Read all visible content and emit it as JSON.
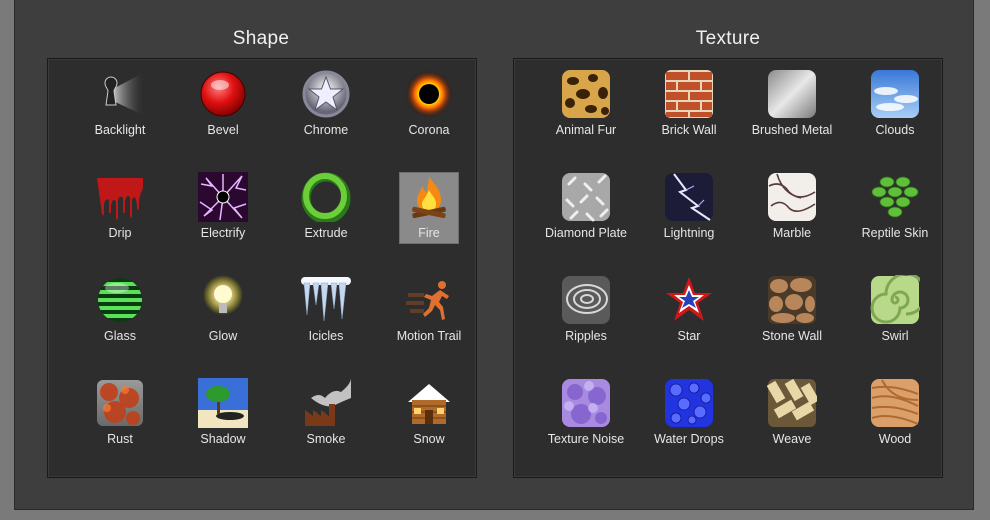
{
  "shape": {
    "title": "Shape",
    "items": [
      {
        "label": "Backlight",
        "icon": "backlight-icon"
      },
      {
        "label": "Bevel",
        "icon": "bevel-icon"
      },
      {
        "label": "Chrome",
        "icon": "chrome-icon"
      },
      {
        "label": "Corona",
        "icon": "corona-icon"
      },
      {
        "label": "Drip",
        "icon": "drip-icon"
      },
      {
        "label": "Electrify",
        "icon": "electrify-icon"
      },
      {
        "label": "Extrude",
        "icon": "extrude-icon"
      },
      {
        "label": "Fire",
        "icon": "fire-icon",
        "selected": true
      },
      {
        "label": "Glass",
        "icon": "glass-icon"
      },
      {
        "label": "Glow",
        "icon": "glow-icon"
      },
      {
        "label": "Icicles",
        "icon": "icicles-icon"
      },
      {
        "label": "Motion Trail",
        "icon": "motion-trail-icon"
      },
      {
        "label": "Rust",
        "icon": "rust-icon"
      },
      {
        "label": "Shadow",
        "icon": "shadow-icon"
      },
      {
        "label": "Smoke",
        "icon": "smoke-icon"
      },
      {
        "label": "Snow",
        "icon": "snow-icon"
      }
    ]
  },
  "texture": {
    "title": "Texture",
    "items": [
      {
        "label": "Animal Fur",
        "icon": "animal-fur-icon"
      },
      {
        "label": "Brick Wall",
        "icon": "brick-wall-icon"
      },
      {
        "label": "Brushed Metal",
        "icon": "brushed-metal-icon"
      },
      {
        "label": "Clouds",
        "icon": "clouds-icon"
      },
      {
        "label": "Diamond Plate",
        "icon": "diamond-plate-icon"
      },
      {
        "label": "Lightning",
        "icon": "lightning-icon"
      },
      {
        "label": "Marble",
        "icon": "marble-icon"
      },
      {
        "label": "Reptile Skin",
        "icon": "reptile-skin-icon"
      },
      {
        "label": "Ripples",
        "icon": "ripples-icon"
      },
      {
        "label": "Star",
        "icon": "star-icon"
      },
      {
        "label": "Stone Wall",
        "icon": "stone-wall-icon"
      },
      {
        "label": "Swirl",
        "icon": "swirl-icon"
      },
      {
        "label": "Texture Noise",
        "icon": "texture-noise-icon"
      },
      {
        "label": "Water Drops",
        "icon": "water-drops-icon"
      },
      {
        "label": "Weave",
        "icon": "weave-icon"
      },
      {
        "label": "Wood",
        "icon": "wood-icon"
      }
    ]
  },
  "colors": {
    "window_bg": "#3e3e3e",
    "grid_bg": "#2d2d2d",
    "selection_bg": "#8a8a8a",
    "text": "#e6e6e6"
  }
}
